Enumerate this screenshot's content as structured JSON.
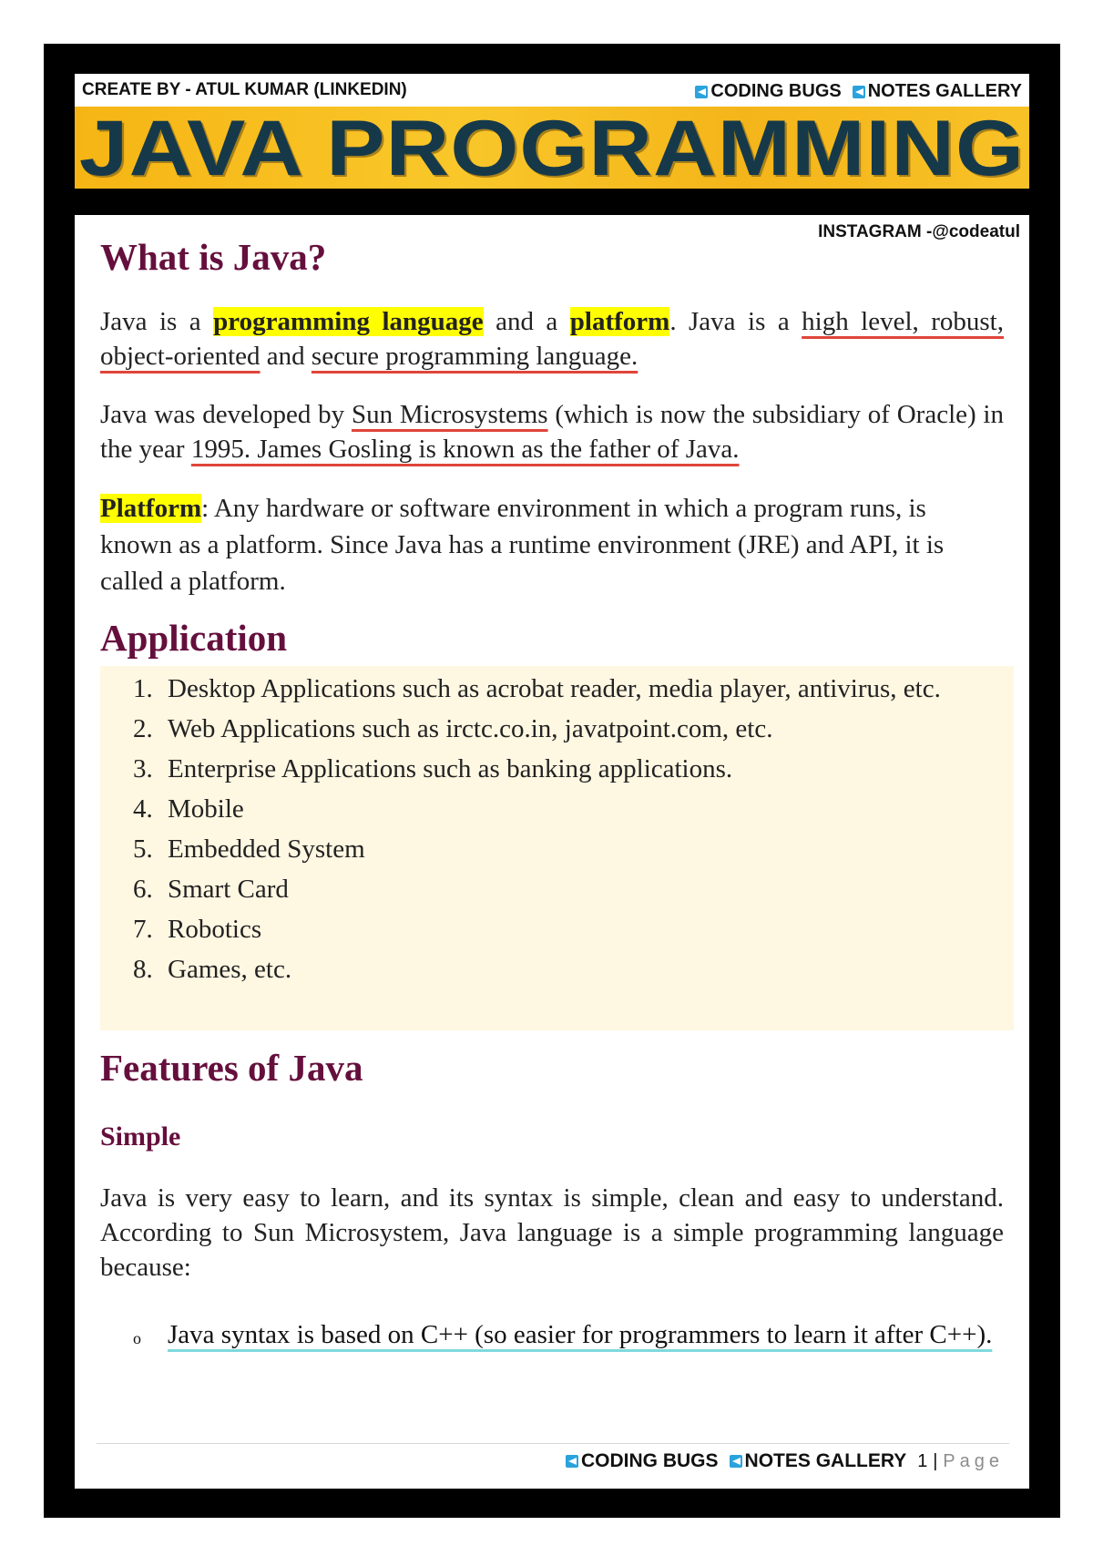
{
  "header": {
    "creator": "CREATE BY - ATUL KUMAR (LINKEDIN)",
    "links": [
      {
        "icon": "telegram-icon",
        "label": "CODING BUGS"
      },
      {
        "icon": "telegram-icon",
        "label": "NOTES GALLERY"
      }
    ],
    "banner_title": "JAVA PROGRAMMING",
    "instagram": "INSTAGRAM -@codeatul"
  },
  "sections": {
    "what_is_java": {
      "heading": "What is Java?",
      "p1": {
        "t1": "Java is a ",
        "hl1": "programming language",
        "t2": " and a ",
        "hl2": "platform",
        "t3": ". Java is a ",
        "u1": "high level, robust, object-oriented",
        "t4": " and ",
        "u2": "secure programming language."
      },
      "p2": {
        "t1": "Java was developed by ",
        "u1": "Sun Microsystems",
        "t2": " (which is now the subsidiary of Oracle) in the year ",
        "u2": "1995. James Gosling is known as the father of Java."
      },
      "p3": {
        "hl": "Platform",
        "text": ": Any hardware or software environment in which a program runs, is known as a platform. Since Java has a runtime environment (JRE) and API, it is called a platform."
      }
    },
    "application": {
      "heading": "Application",
      "items": [
        {
          "num": "1.",
          "text": "Desktop Applications such as acrobat reader, media player, antivirus, etc."
        },
        {
          "num": "2.",
          "text": "Web Applications such as irctc.co.in, javatpoint.com, etc."
        },
        {
          "num": "3.",
          "text": "Enterprise Applications such as banking applications."
        },
        {
          "num": "4.",
          "text": "Mobile"
        },
        {
          "num": "5.",
          "text": "Embedded System"
        },
        {
          "num": "6.",
          "text": "Smart Card"
        },
        {
          "num": "7.",
          "text": "Robotics"
        },
        {
          "num": "8.",
          "text": "Games, etc."
        }
      ]
    },
    "features": {
      "heading": "Features of Java",
      "simple": {
        "heading": "Simple",
        "paragraph": "Java is very easy to learn, and its syntax is simple, clean and easy to understand. According to Sun Microsystem, Java language is a simple programming language because:",
        "bullets": [
          {
            "marker": "o",
            "text": "Java syntax is based on C++ (so easier for programmers to learn it after C++)."
          }
        ]
      }
    }
  },
  "footer": {
    "links": [
      {
        "icon": "telegram-icon",
        "label": "CODING BUGS"
      },
      {
        "icon": "telegram-icon",
        "label": "NOTES GALLERY"
      }
    ],
    "page_number": "1",
    "separator": "|",
    "page_label": "Page"
  },
  "colors": {
    "heading": "#650f3d",
    "highlight": "#ffff00",
    "underline_red": "#e0453a",
    "underline_cyan": "#7fd9de",
    "list_background": "#fef7e2",
    "banner": "#f6b514",
    "banner_text": "#16394a",
    "telegram": "#2aa3dd"
  }
}
